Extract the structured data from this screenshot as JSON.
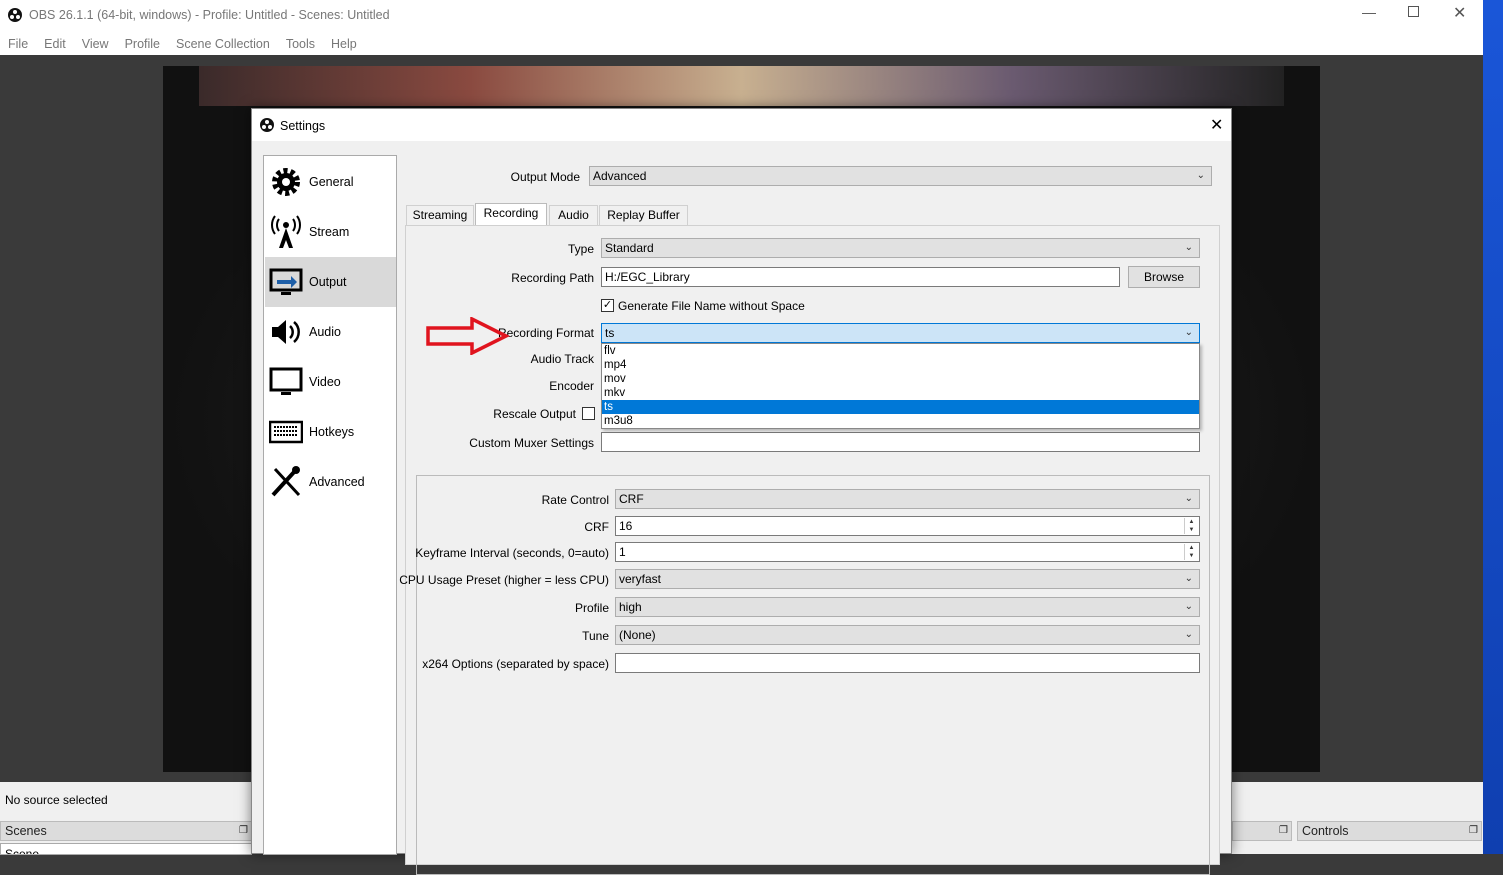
{
  "window": {
    "title": "OBS 26.1.1 (64-bit, windows) - Profile: Untitled - Scenes: Untitled"
  },
  "menu": [
    "File",
    "Edit",
    "View",
    "Profile",
    "Scene Collection",
    "Tools",
    "Help"
  ],
  "bottom": {
    "status": "No source selected",
    "scenes_dock": "Scenes",
    "scene_header": "Scene",
    "controls_dock": "Controls"
  },
  "dialog": {
    "title": "Settings",
    "sidebar": [
      {
        "label": "General",
        "icon": "gear-icon"
      },
      {
        "label": "Stream",
        "icon": "antenna-icon"
      },
      {
        "label": "Output",
        "icon": "monitor-arrow-icon",
        "selected": true
      },
      {
        "label": "Audio",
        "icon": "speaker-icon"
      },
      {
        "label": "Video",
        "icon": "monitor-icon"
      },
      {
        "label": "Hotkeys",
        "icon": "keyboard-icon"
      },
      {
        "label": "Advanced",
        "icon": "tools-icon"
      }
    ],
    "output_mode": {
      "label": "Output Mode",
      "value": "Advanced"
    },
    "tabs": [
      "Streaming",
      "Recording",
      "Audio",
      "Replay Buffer"
    ],
    "active_tab": "Recording",
    "recording": {
      "type": {
        "label": "Type",
        "value": "Standard"
      },
      "path": {
        "label": "Recording Path",
        "value": "H:/EGC_Library",
        "browse": "Browse"
      },
      "gen_name": {
        "label": "Generate File Name without Space",
        "checked": true
      },
      "format": {
        "label": "Recording Format",
        "value": "ts",
        "options": [
          "flv",
          "mp4",
          "mov",
          "mkv",
          "ts",
          "m3u8"
        ]
      },
      "audio_track": {
        "label": "Audio Track"
      },
      "encoder": {
        "label": "Encoder"
      },
      "rescale": {
        "label": "Rescale Output",
        "checked": false
      },
      "muxer": {
        "label": "Custom Muxer Settings",
        "value": ""
      }
    },
    "encoder_settings": [
      {
        "label": "Rate Control",
        "value": "CRF",
        "kind": "select"
      },
      {
        "label": "CRF",
        "value": "16",
        "kind": "spin"
      },
      {
        "label": "Keyframe Interval (seconds, 0=auto)",
        "value": "1",
        "kind": "spin"
      },
      {
        "label": "CPU Usage Preset (higher = less CPU)",
        "value": "veryfast",
        "kind": "select"
      },
      {
        "label": "Profile",
        "value": "high",
        "kind": "select"
      },
      {
        "label": "Tune",
        "value": "(None)",
        "kind": "select"
      },
      {
        "label": "x264 Options (separated by space)",
        "value": "",
        "kind": "input"
      }
    ]
  },
  "annotation": {
    "color": "#e0141e"
  }
}
